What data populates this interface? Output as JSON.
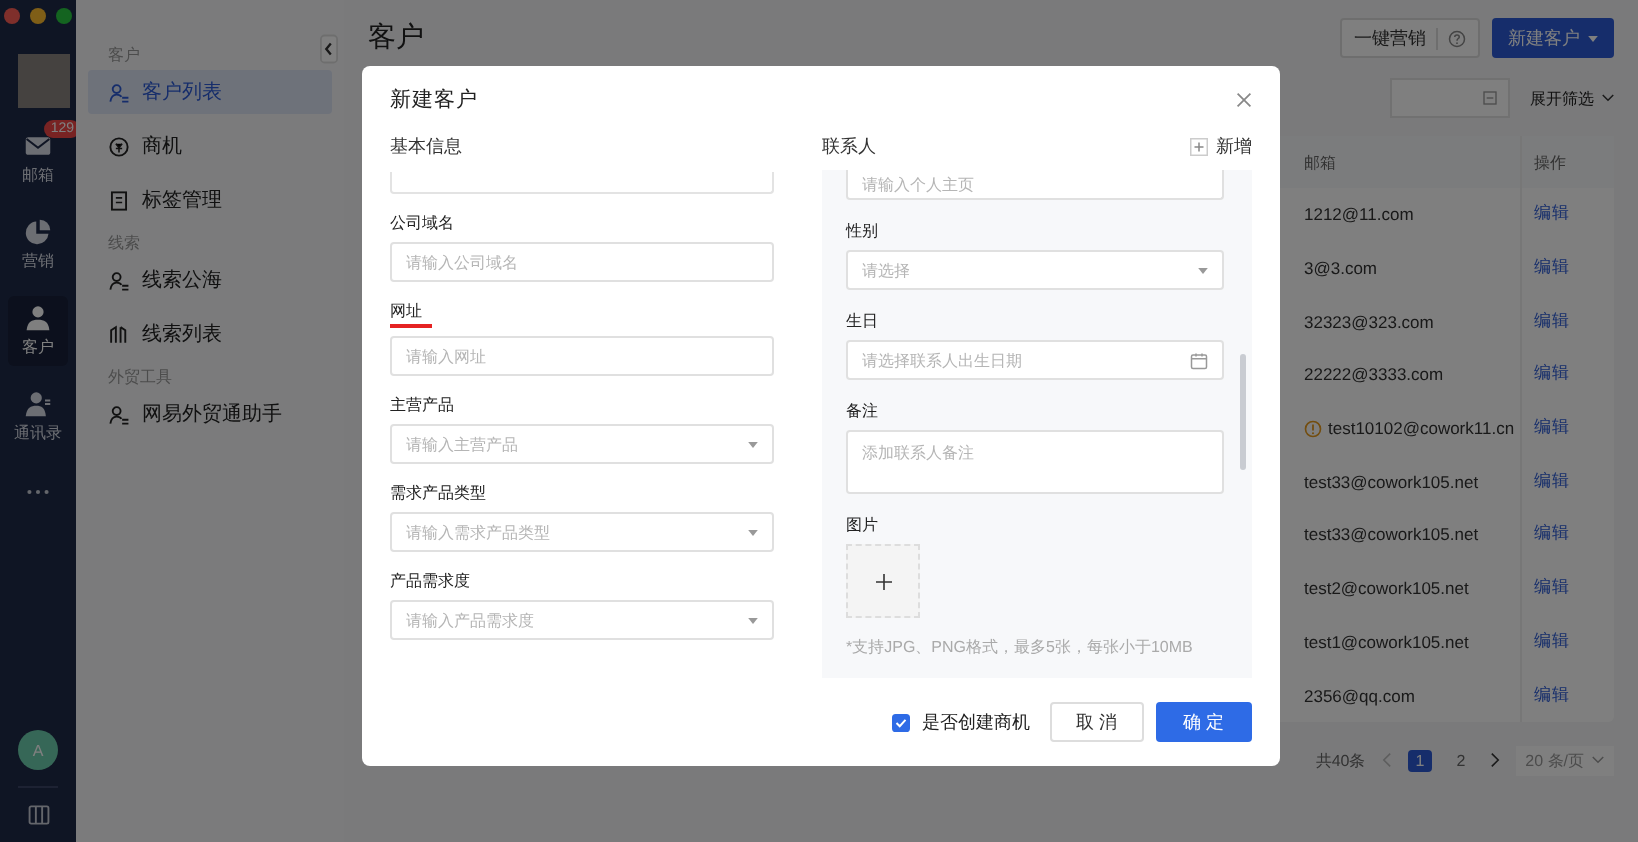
{
  "app_rail": {
    "items": [
      {
        "label": "邮箱",
        "kind": "mail",
        "badge": "129",
        "selected": false
      },
      {
        "label": "营销",
        "kind": "pie",
        "selected": false
      },
      {
        "label": "客户",
        "kind": "person",
        "selected": true
      },
      {
        "label": "通讯录",
        "kind": "contacts",
        "selected": false
      }
    ],
    "avatar": "A"
  },
  "sidebar": {
    "groups": [
      {
        "title": "客户",
        "items": [
          {
            "label": "客户列表",
            "kind": "people",
            "selected": true
          },
          {
            "label": "商机",
            "kind": "coin",
            "selected": false
          },
          {
            "label": "标签管理",
            "kind": "tag",
            "selected": false
          }
        ]
      },
      {
        "title": "线索",
        "items": [
          {
            "label": "线索公海",
            "kind": "person",
            "selected": false
          },
          {
            "label": "线索列表",
            "kind": "list",
            "selected": false
          }
        ]
      },
      {
        "title": "外贸工具",
        "items": [
          {
            "label": "网易外贸通助手",
            "kind": "person",
            "selected": false
          }
        ]
      }
    ]
  },
  "page": {
    "title": "客户",
    "marketing_button": "一键营销",
    "new_button": "新建客户",
    "expand_filter": "展开筛选"
  },
  "table": {
    "columns": [
      "邮箱",
      "操作"
    ],
    "rows": [
      {
        "email": "1212@11.com",
        "warning": false,
        "action": "编辑"
      },
      {
        "email": "3@3.com",
        "warning": false,
        "action": "编辑"
      },
      {
        "email": "32323@323.com",
        "warning": false,
        "action": "编辑"
      },
      {
        "email": "22222@3333.com",
        "warning": false,
        "action": "编辑"
      },
      {
        "email": "test10102@cowork11.cn",
        "warning": true,
        "action": "编辑"
      },
      {
        "email": "test33@cowork105.net",
        "warning": false,
        "action": "编辑"
      },
      {
        "email": "test33@cowork105.net",
        "warning": false,
        "action": "编辑"
      },
      {
        "email": "test2@cowork105.net",
        "warning": false,
        "action": "编辑"
      },
      {
        "email": "test1@cowork105.net",
        "warning": false,
        "action": "编辑"
      },
      {
        "email": "2356@qq.com",
        "warning": false,
        "action": "编辑"
      }
    ]
  },
  "pagination": {
    "total": "共40条",
    "pages": [
      {
        "label": "1",
        "selected": true
      },
      {
        "label": "2",
        "selected": false
      }
    ],
    "page_size": "20 条/页"
  },
  "modal": {
    "title": "新建客户",
    "basic_section": "基本信息",
    "contact_section": "联系人",
    "add_button": "新增",
    "basic_fields": [
      {
        "label": "公司域名",
        "placeholder": "请输入公司域名",
        "kind": "input",
        "underlined": false
      },
      {
        "label": "网址",
        "placeholder": "请输入网址",
        "kind": "input",
        "underlined": true
      },
      {
        "label": "主营产品",
        "placeholder": "请输入主营产品",
        "kind": "select",
        "underlined": false
      },
      {
        "label": "需求产品类型",
        "placeholder": "请输入需求产品类型",
        "kind": "select",
        "underlined": false
      },
      {
        "label": "产品需求度",
        "placeholder": "请输入产品需求度",
        "kind": "select",
        "underlined": false
      }
    ],
    "contact_fields": [
      {
        "kind": "input",
        "placeholder": "请输入个人主页"
      },
      {
        "label": "性别",
        "kind": "select",
        "placeholder": "请选择"
      },
      {
        "label": "生日",
        "kind": "date",
        "placeholder": "请选择联系人出生日期"
      },
      {
        "label": "备注",
        "kind": "textarea",
        "placeholder": "添加联系人备注"
      },
      {
        "label": "图片",
        "kind": "upload"
      }
    ],
    "upload_hint": "*支持JPG、PNG格式，最多5张，每张小于10MB",
    "create_opportunity": {
      "label": "是否创建商机",
      "checked": true
    },
    "cancel": "取 消",
    "confirm": "确 定"
  }
}
